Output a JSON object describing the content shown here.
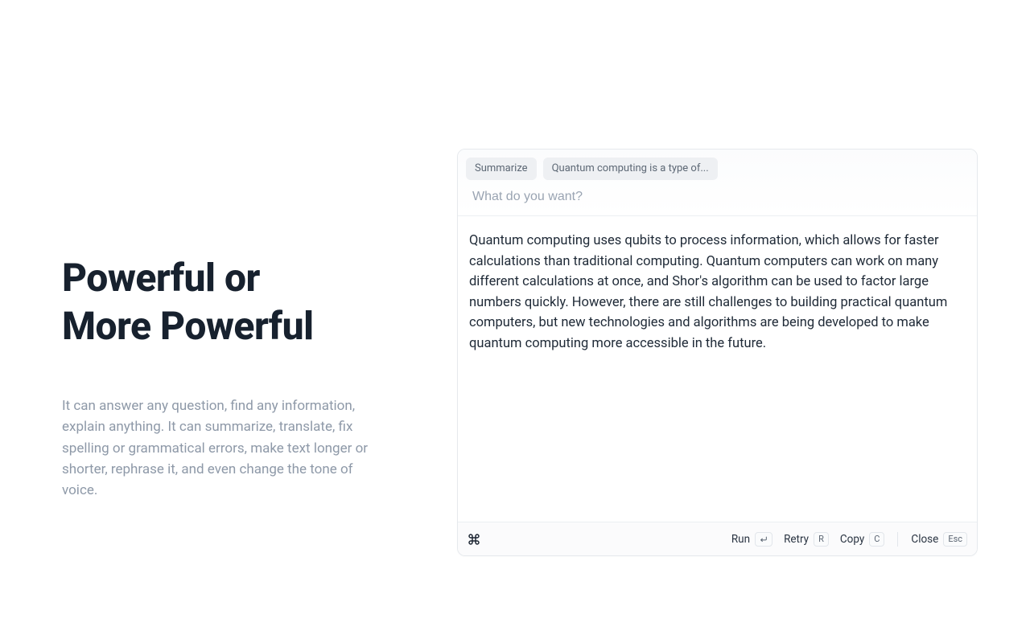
{
  "hero": {
    "headline_line1": "Powerful or",
    "headline_line2": "More Powerful",
    "subtext": "It can answer any question, find any information, explain anything. It can summarize, translate, fix spelling or grammatical errors, make text longer or shorter, rephrase it, and even change the tone of voice."
  },
  "card": {
    "chips": {
      "action": "Summarize",
      "context": "Quantum computing is a type of..."
    },
    "input": {
      "placeholder": "What do you want?",
      "value": ""
    },
    "output": "Quantum computing uses qubits to process information, which allows for faster calculations than traditional computing. Quantum computers can work on many different calculations at once, and Shor's algorithm can be used to factor large numbers quickly. However, there are still challenges to building practical quantum computers, but new technologies and algorithms are being developed to make quantum computing more accessible in the future.",
    "footer": {
      "run": {
        "label": "Run",
        "shortcut_icon": "return"
      },
      "retry": {
        "label": "Retry",
        "shortcut": "R"
      },
      "copy": {
        "label": "Copy",
        "shortcut": "C"
      },
      "close": {
        "label": "Close",
        "shortcut": "Esc"
      }
    }
  }
}
